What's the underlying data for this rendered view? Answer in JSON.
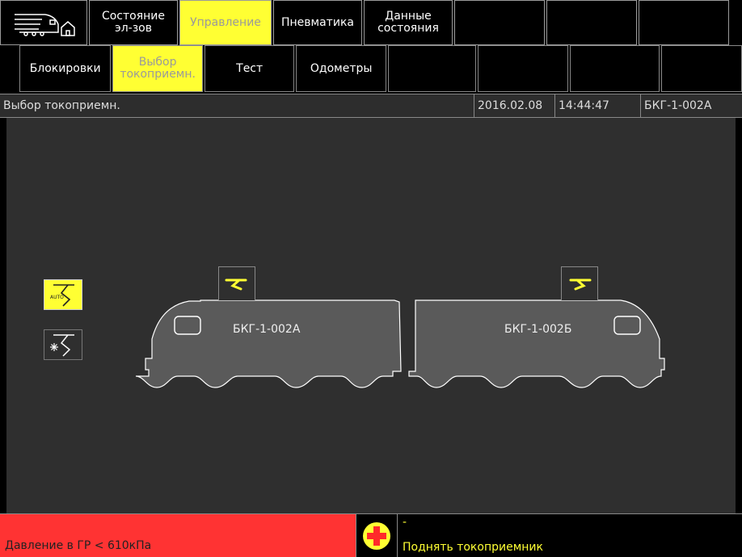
{
  "nav_top": [
    {
      "label": "",
      "kind": "menu-icon"
    },
    {
      "label": "Состояние\nэл-зов"
    },
    {
      "label": "Управление",
      "active": true
    },
    {
      "label": "Пневматика"
    },
    {
      "label": "Данные\nсостояния"
    },
    {
      "label": ""
    },
    {
      "label": ""
    },
    {
      "label": ""
    }
  ],
  "nav_sub": [
    {
      "label": "Блокировки"
    },
    {
      "label": "Выбор\nтокоприемн.",
      "active": true
    },
    {
      "label": "Тест"
    },
    {
      "label": "Одометры"
    },
    {
      "label": ""
    },
    {
      "label": ""
    },
    {
      "label": ""
    },
    {
      "label": ""
    }
  ],
  "status": {
    "title": "Выбор токоприемн.",
    "date": "2016.02.08",
    "time": "14:44:47",
    "unit": "БКГ-1-002А"
  },
  "cars": {
    "a_label": "БКГ-1-002А",
    "b_label": "БКГ-1-002Б"
  },
  "side_buttons": {
    "auto_icon": "pantograph-auto-icon",
    "freeze_icon": "pantograph-freeze-icon",
    "auto_text": "AUTO"
  },
  "alarm": {
    "text": "Давление в ГР < 610кПа",
    "color": "#ff3333",
    "message_dash": "-",
    "message": "Поднять токоприемник"
  },
  "colors": {
    "accent": "#ffff33",
    "background": "#2f2f2f"
  }
}
